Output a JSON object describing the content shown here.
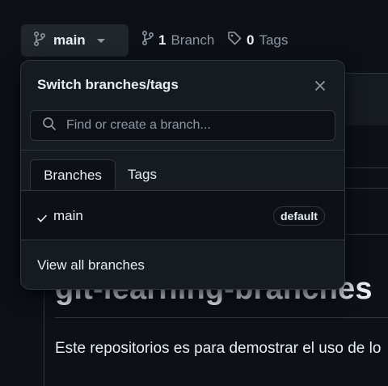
{
  "branch_selector": {
    "current_branch": "main",
    "icon": "git-branch-icon",
    "caret": "triangle-down-icon"
  },
  "branches_link": {
    "count": "1",
    "label": "Branch",
    "icon": "git-branch-icon"
  },
  "tags_link": {
    "count": "0",
    "label": "Tags",
    "icon": "tag-icon"
  },
  "dropdown": {
    "title": "Switch branches/tags",
    "close_icon": "x-icon",
    "search": {
      "placeholder": "Find or create a branch...",
      "value": "",
      "icon": "search-icon"
    },
    "tabs": [
      {
        "label": "Branches",
        "active": true
      },
      {
        "label": "Tags",
        "active": false
      }
    ],
    "items": [
      {
        "name": "main",
        "checked": true,
        "badge": "default"
      }
    ],
    "footer_link": "View all branches"
  },
  "repo": {
    "title": "git-learning-branches",
    "description": "Este repositorios es para demostrar el uso de lo"
  },
  "colors": {
    "background": "#0d1117",
    "surface": "#161b22",
    "border": "#30363d",
    "text": "#e6edf3",
    "muted": "#8d96a0"
  }
}
